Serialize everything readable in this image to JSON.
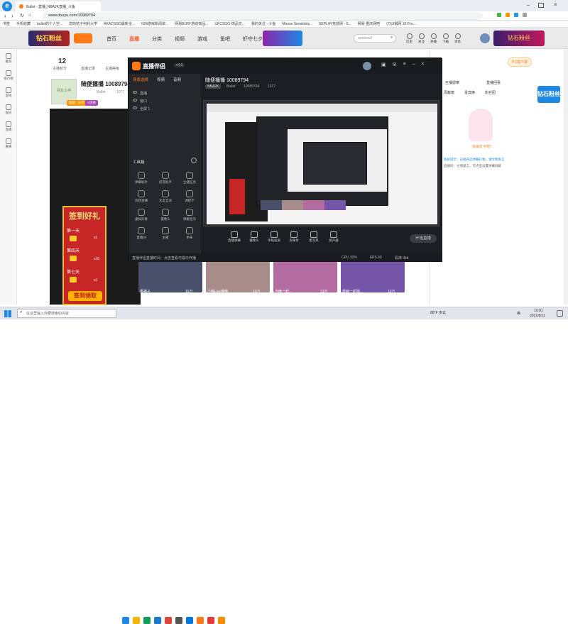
{
  "browser": {
    "tab_title": "Bullet - 直播_NBA2K直播_斗鱼",
    "url": "www.douyu.com/10089794",
    "bookmarks": [
      "书签",
      "手机收藏",
      "bullet的个人空...",
      "您的杭子利利大学",
      "AKACSGO最新全...",
      "IGN游戏新闻资...",
      "网易BUFF游戏饰品...",
      "UKCSGO-饰品交...",
      "我的关注 - 斗鱼",
      "Mouse Sensitivity...",
      "SEPLAY竞技网 - 5...",
      "网易-重庆网吧",
      "(7)UI钢网 10 Pro..."
    ]
  },
  "site": {
    "nav": [
      "首页",
      "直播",
      "分类",
      "视频",
      "游戏",
      "鱼吧",
      "虾守七夕"
    ],
    "search_placeholder": "rainbow6",
    "user_links": [
      "历史",
      "关注",
      "开播",
      "下载",
      "消息"
    ],
    "promo_text": "钻石粉丝",
    "pc_client": "PC客户端",
    "sidebar": [
      "推荐",
      "排行榜",
      "游戏",
      "娱乐",
      "直播",
      "赛事"
    ]
  },
  "room": {
    "count": "12",
    "labels": [
      "主播积分",
      "直播记录",
      "主播等级"
    ],
    "title": "随便播播 10089794",
    "streamer": "Bullet",
    "fans": "1077",
    "tags": [
      "超级 · 分享",
      "V优秀"
    ],
    "placeholder_text": "网友太神"
  },
  "obs": {
    "app_name": "直播伴侣",
    "version": "v4.0",
    "menu": [
      "场景选择",
      "视频",
      "音频"
    ],
    "stream_title": "随便播播 10089794",
    "category": "NBA2K",
    "streamer": "Bullet",
    "room_id": "10089794",
    "fans": "1077",
    "scenes": [
      "直播",
      "窗口",
      "全屏 1"
    ],
    "tools_header": "工具箱",
    "tools": [
      "弹幕助手",
      "房管助手",
      "主播任务",
      "玩转直播",
      "水友互动",
      "课程学",
      "虚拟形象",
      "摄像头",
      "弹幕显示",
      "直播间",
      "主播",
      "更多"
    ],
    "controls": [
      "直播弹幕",
      "摄像头",
      "手机投屏",
      "多媒体",
      "麦克风",
      "扬声器"
    ],
    "start_button": "开始直播",
    "notice": "直播伴侣直播时间：点击查看可提示开播",
    "status": [
      "CPU 32%",
      "FPS 60",
      "码率 0kb"
    ]
  },
  "right_panel": {
    "tabs": [
      "贡献榜",
      "贵宾席",
      "粉丝团"
    ],
    "side_links": [
      "主播勋章",
      "直播回看"
    ],
    "mascot_text": "快来打卡吧！",
    "chat_notice": "系统提示：已经开启弹幕礼物，请文明发言",
    "chat_line": "直播间：文明发言，可点击设置弹幕屏蔽"
  },
  "ad": {
    "title": "签到好礼",
    "days": [
      "第一天",
      "第四天",
      "第七天"
    ],
    "rewards": [
      "x1",
      "x10",
      "x1"
    ],
    "button": "签到领取"
  },
  "thumbs": [
    {
      "title": "香猪子",
      "views": "15万",
      "color": "#4a4f6a"
    },
    {
      "title": "小喵Live哦哦",
      "views": "10万",
      "color": "#a88b8b"
    },
    {
      "title": "今晚一起...",
      "views": "13万",
      "color": "#b26ca0"
    },
    {
      "title": "最萌一起搞...",
      "views": "13万",
      "color": "#7455a8"
    }
  ],
  "taskbar": {
    "search_placeholder": "在这里输入你要搜索的内容",
    "weather": "88°F 多云",
    "time": "10:01",
    "date": "2021/8/11",
    "lang": "英"
  },
  "colors": {
    "accent": "#ff5d23",
    "douyu_orange": "#ff7a15",
    "obs_bg": "#232428",
    "badge_red": "#e53935"
  }
}
